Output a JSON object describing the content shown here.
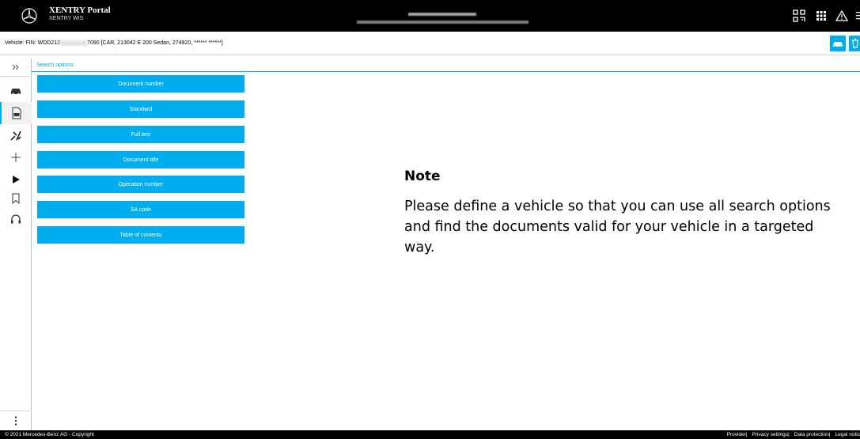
{
  "header": {
    "brand_title": "XENTRY Portal",
    "brand_subtitle": "XENTRY WIS"
  },
  "vehicle": {
    "label": "Vehicle:",
    "fin_prefix": "FIN: WDD212",
    "fin_suffix": "7090 [CAR, 213042 E 200 Sedan, 274920, ****** ******]"
  },
  "search": {
    "header": "Search options",
    "options": [
      "Document number",
      "Standard",
      "Full text",
      "Document title",
      "Operation number",
      "SA code",
      "Table of contents"
    ]
  },
  "note": {
    "title": "Note",
    "body": "Please define a vehicle so that you can use all search options and find the documents valid for your vehicle in a targeted way."
  },
  "footer": {
    "copyright": "© 2021 Mercedes-Benz AG - Copyright",
    "links": [
      "Provider",
      "Privacy settings",
      "Data protection",
      "Legal notic"
    ]
  },
  "colors": {
    "accent": "#00adef",
    "header_bg": "#000000"
  }
}
